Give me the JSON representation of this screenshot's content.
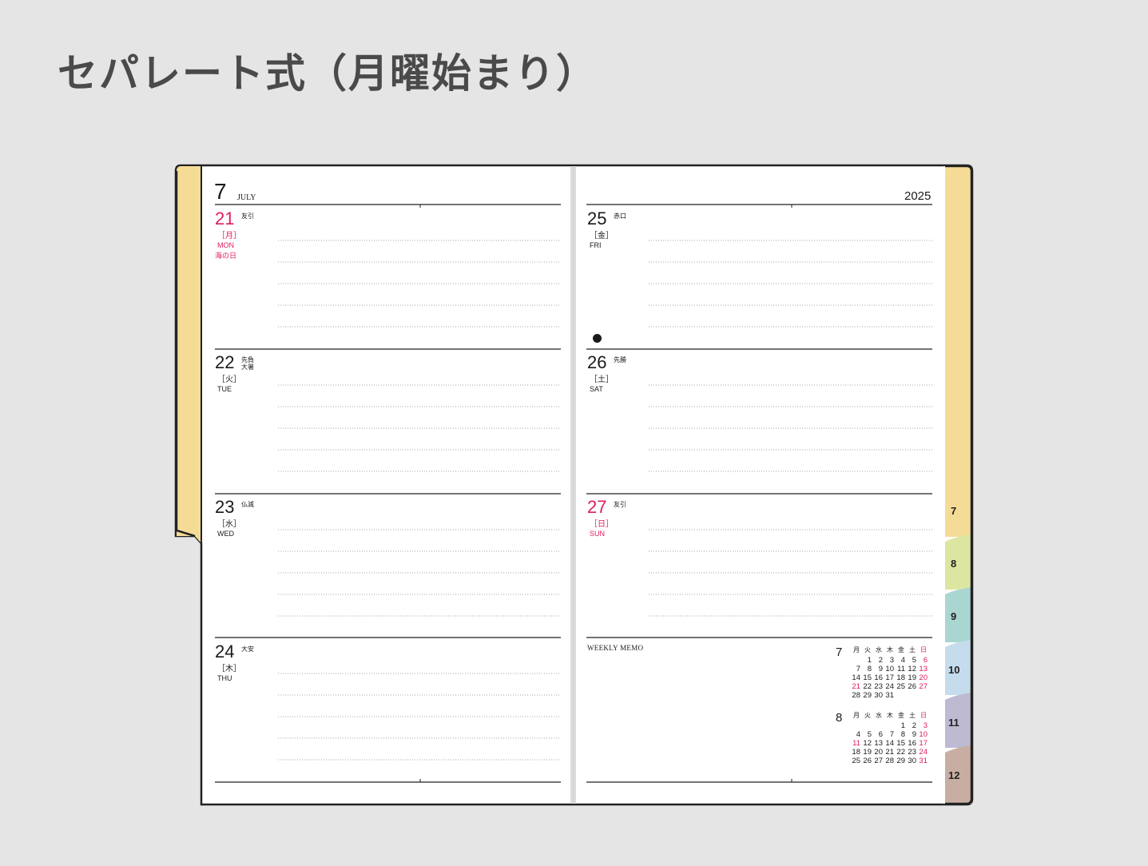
{
  "title": "セパレート式（月曜始まり）",
  "month_number": "7",
  "month_name": "JULY",
  "year": "2025",
  "weekly_memo_label": "WEEKLY MEMO",
  "left_days": [
    {
      "day": "21",
      "rokuyo": "友引",
      "dow_jp": "［月］",
      "dow_en": "MON",
      "holiday": "海の日",
      "red": true
    },
    {
      "day": "22",
      "rokuyo": "先負\n大暑",
      "dow_jp": "［火］",
      "dow_en": "TUE",
      "holiday": "",
      "red": false
    },
    {
      "day": "23",
      "rokuyo": "仏滅",
      "dow_jp": "［水］",
      "dow_en": "WED",
      "holiday": "",
      "red": false
    },
    {
      "day": "24",
      "rokuyo": "大安",
      "dow_jp": "［木］",
      "dow_en": "THU",
      "holiday": "",
      "red": false
    }
  ],
  "right_days": [
    {
      "day": "25",
      "rokuyo": "赤口",
      "dow_jp": "［金］",
      "dow_en": "FRI",
      "holiday": "",
      "red": false,
      "moon": true
    },
    {
      "day": "26",
      "rokuyo": "先勝",
      "dow_jp": "［土］",
      "dow_en": "SAT",
      "holiday": "",
      "red": false
    },
    {
      "day": "27",
      "rokuyo": "友引",
      "dow_jp": "［日］",
      "dow_en": "SUN",
      "holiday": "",
      "red": true
    }
  ],
  "mini_calendars": [
    {
      "month": "7",
      "headers": [
        "月",
        "火",
        "水",
        "木",
        "金",
        "土",
        "日"
      ],
      "weeks": [
        [
          "",
          "1",
          "2",
          "3",
          "4",
          "5",
          "6"
        ],
        [
          "7",
          "8",
          "9",
          "10",
          "11",
          "12",
          "13"
        ],
        [
          "14",
          "15",
          "16",
          "17",
          "18",
          "19",
          "20"
        ],
        [
          "21",
          "22",
          "23",
          "24",
          "25",
          "26",
          "27"
        ],
        [
          "28",
          "29",
          "30",
          "31",
          "",
          "",
          ""
        ]
      ],
      "red_dates": [
        "6",
        "13",
        "20",
        "21",
        "27"
      ]
    },
    {
      "month": "8",
      "headers": [
        "月",
        "火",
        "水",
        "木",
        "金",
        "土",
        "日"
      ],
      "weeks": [
        [
          "",
          "",
          "",
          "",
          "1",
          "2",
          "3"
        ],
        [
          "4",
          "5",
          "6",
          "7",
          "8",
          "9",
          "10"
        ],
        [
          "11",
          "12",
          "13",
          "14",
          "15",
          "16",
          "17"
        ],
        [
          "18",
          "19",
          "20",
          "21",
          "22",
          "23",
          "24"
        ],
        [
          "25",
          "26",
          "27",
          "28",
          "29",
          "30",
          "31"
        ]
      ],
      "red_dates": [
        "3",
        "10",
        "11",
        "17",
        "24",
        "31"
      ]
    }
  ],
  "tabs": [
    {
      "label": "7",
      "color": "#f5dc96"
    },
    {
      "label": "8",
      "color": "#dde6a0"
    },
    {
      "label": "9",
      "color": "#aad6d2"
    },
    {
      "label": "10",
      "color": "#c4dcec"
    },
    {
      "label": "11",
      "color": "#bdbad2"
    },
    {
      "label": "12",
      "color": "#c8aea2"
    }
  ],
  "colors": {
    "background": "#e5e5e5",
    "accent_red": "#e01a62",
    "left_tab": "#f5dc96",
    "page": "#ffffff",
    "outline": "#222222"
  }
}
